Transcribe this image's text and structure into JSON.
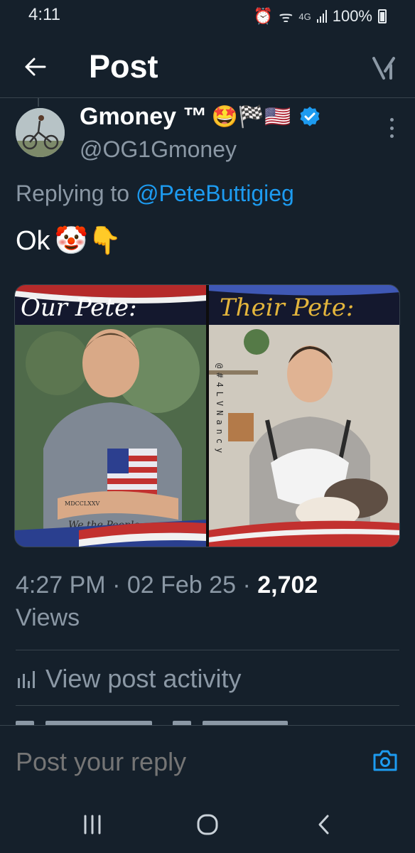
{
  "status_bar": {
    "time": "4:11",
    "network": "4G",
    "battery": "100%"
  },
  "header": {
    "title": "Post"
  },
  "author": {
    "display_name": "Gmoney ™",
    "emojis": "🤩🏁🇺🇸",
    "handle": "@OG1Gmoney",
    "verified": true
  },
  "reply_context": {
    "prefix": "Replying to",
    "mention": "@PeteButtigieg"
  },
  "post": {
    "text": "Ok",
    "emojis": "🤡👇"
  },
  "media": {
    "left_caption": "Our Pete:",
    "right_caption": "Their Pete:",
    "tattoo_upper": "MDCCLXXV",
    "tattoo_lower": "We the People",
    "watermark": "@#4LVNancy"
  },
  "meta": {
    "time": "4:27 PM",
    "date": "02 Feb 25",
    "views_count": "2,702",
    "views_label": "Views"
  },
  "activity": {
    "label": "View post activity"
  },
  "reply_bar": {
    "placeholder": "Post your reply"
  },
  "colors": {
    "background": "#15202b",
    "accent": "#1d9bf0",
    "secondary_text": "#8b98a5",
    "divider": "#38444d"
  },
  "icons": {
    "back": "arrow-left-icon",
    "grok": "grok-icon",
    "more": "more-vertical-icon",
    "verified": "verified-badge-icon",
    "activity": "bar-chart-icon",
    "camera": "camera-icon",
    "recents": "recents-icon",
    "home": "home-icon",
    "nav_back": "nav-back-icon"
  }
}
